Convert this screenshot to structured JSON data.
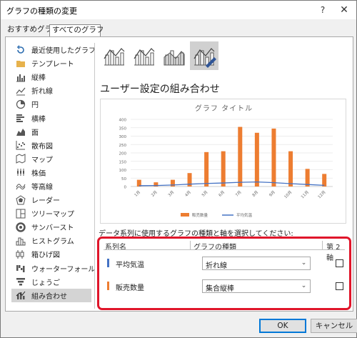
{
  "window": {
    "title": "グラフの種類の変更",
    "help_label": "?",
    "close_label": "✕"
  },
  "tabs": [
    {
      "label": "おすすめグラフ",
      "active": false
    },
    {
      "label": "すべてのグラフ",
      "active": true
    }
  ],
  "sidebar": {
    "items": [
      {
        "label": "最近使用したグラフ",
        "icon": "recent-icon",
        "color": "#2b6cb0"
      },
      {
        "label": "テンプレート",
        "icon": "folder-icon",
        "color": "#e7b24c"
      },
      {
        "label": "縦棒",
        "icon": "column-chart-icon",
        "color": "#555555"
      },
      {
        "label": "折れ線",
        "icon": "line-chart-icon",
        "color": "#555555"
      },
      {
        "label": "円",
        "icon": "pie-chart-icon",
        "color": "#555555"
      },
      {
        "label": "横棒",
        "icon": "bar-chart-icon",
        "color": "#555555"
      },
      {
        "label": "面",
        "icon": "area-chart-icon",
        "color": "#555555"
      },
      {
        "label": "散布図",
        "icon": "scatter-chart-icon",
        "color": "#555555"
      },
      {
        "label": "マップ",
        "icon": "map-chart-icon",
        "color": "#555555"
      },
      {
        "label": "株価",
        "icon": "stock-chart-icon",
        "color": "#555555"
      },
      {
        "label": "等高線",
        "icon": "surface-chart-icon",
        "color": "#555555"
      },
      {
        "label": "レーダー",
        "icon": "radar-chart-icon",
        "color": "#555555"
      },
      {
        "label": "ツリーマップ",
        "icon": "treemap-icon",
        "color": "#555555"
      },
      {
        "label": "サンバースト",
        "icon": "sunburst-icon",
        "color": "#555555"
      },
      {
        "label": "ヒストグラム",
        "icon": "histogram-icon",
        "color": "#555555"
      },
      {
        "label": "箱ひげ図",
        "icon": "box-whisker-icon",
        "color": "#555555"
      },
      {
        "label": "ウォーターフォール",
        "icon": "waterfall-icon",
        "color": "#555555"
      },
      {
        "label": "じょうご",
        "icon": "funnel-icon",
        "color": "#555555"
      },
      {
        "label": "組み合わせ",
        "icon": "combo-chart-icon",
        "color": "#555555",
        "selected": true
      }
    ]
  },
  "subtypes": [
    {
      "icon": "clustered-column-line-icon",
      "selected": false
    },
    {
      "icon": "clustered-column-line-secondary-icon",
      "selected": false
    },
    {
      "icon": "stacked-area-column-icon",
      "selected": false
    },
    {
      "icon": "custom-combination-icon",
      "selected": true
    }
  ],
  "heading": "ユーザー設定の組み合わせ",
  "preview": {
    "chart_data": {
      "type": "bar",
      "title": "グラフ タイトル",
      "categories": [
        "1月",
        "2月",
        "3月",
        "4月",
        "5月",
        "6月",
        "7月",
        "8月",
        "9月",
        "10月",
        "11月",
        "12月"
      ],
      "series": [
        {
          "name": "販売数量",
          "type": "bar",
          "color": "#ed7d31",
          "values": [
            40,
            25,
            40,
            80,
            205,
            210,
            355,
            320,
            345,
            210,
            105,
            75
          ]
        },
        {
          "name": "平均気温",
          "type": "line",
          "color": "#4472c4",
          "values": [
            5,
            6,
            9,
            14,
            18,
            21,
            25,
            27,
            23,
            17,
            12,
            7
          ]
        }
      ],
      "y_ticks": [
        0,
        50,
        100,
        150,
        200,
        250,
        300,
        350,
        400
      ],
      "ylim": [
        0,
        400
      ],
      "grid": true,
      "legend": "bottom"
    }
  },
  "instruction": "データ系列に使用するグラフの種類と軸を選択してください:",
  "series_table": {
    "col_name": "系列名",
    "col_type": "グラフの種類",
    "col_axis": "第 2 軸",
    "rows": [
      {
        "name": "平均気温",
        "color": "#4472c4",
        "type_value": "折れ線",
        "secondary_axis": false
      },
      {
        "name": "販売数量",
        "color": "#ed7d31",
        "type_value": "集合縦棒",
        "secondary_axis": false
      }
    ],
    "highlight_color": "#e0152a"
  },
  "buttons": {
    "ok": "OK",
    "cancel": "キャンセル"
  }
}
